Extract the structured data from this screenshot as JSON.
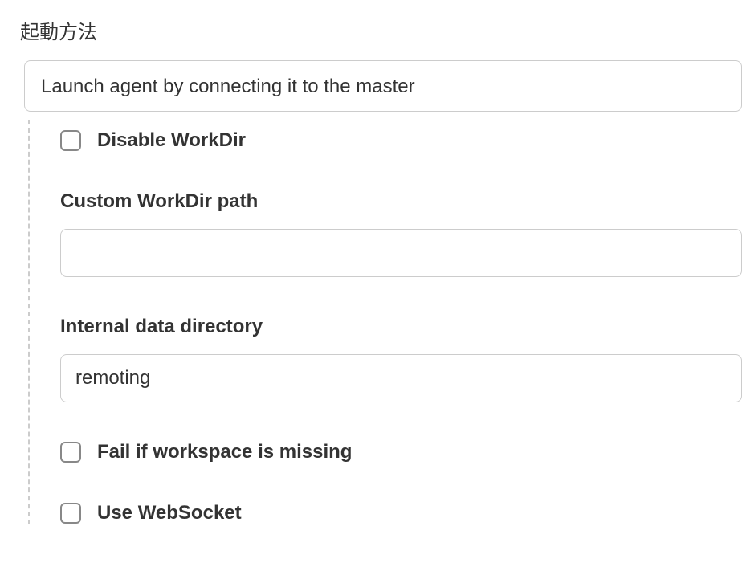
{
  "launchMethod": {
    "label": "起動方法",
    "selected": "Launch agent by connecting it to the master"
  },
  "options": {
    "disableWorkDir": {
      "label": "Disable WorkDir",
      "checked": false
    },
    "customWorkDirPath": {
      "label": "Custom WorkDir path",
      "value": ""
    },
    "internalDataDirectory": {
      "label": "Internal data directory",
      "value": "remoting"
    },
    "failIfWorkspaceMissing": {
      "label": "Fail if workspace is missing",
      "checked": false
    },
    "useWebSocket": {
      "label": "Use WebSocket",
      "checked": false
    }
  }
}
